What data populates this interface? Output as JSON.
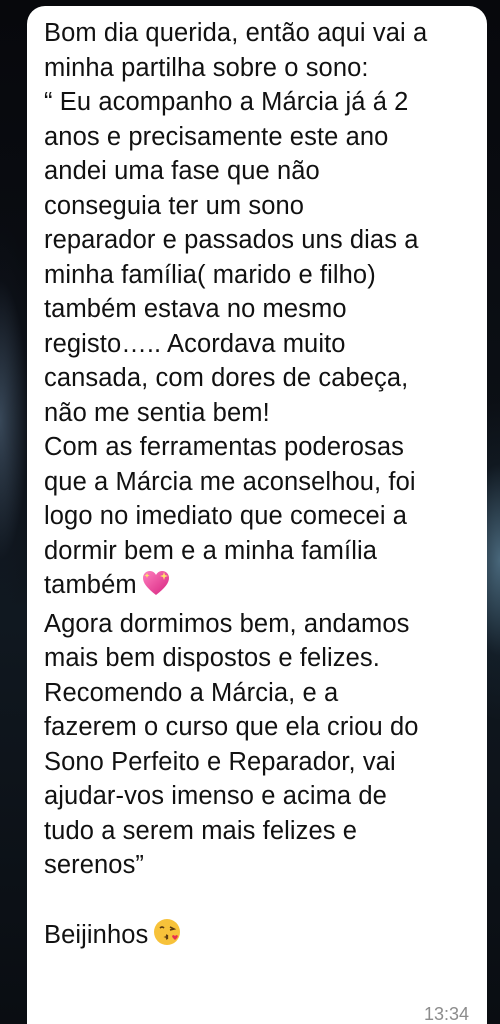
{
  "message": {
    "lines_before_heart": "Bom dia querida, então aqui vai a\nminha partilha sobre o sono:\n“ Eu acompanho a Márcia já á 2\nanos e precisamente este ano\nandei uma fase que não\nconseguia ter um sono\nreparador e passados uns dias a\nminha família( marido e filho)\ntambém estava no mesmo\nregisto….. Acordava muito\ncansada, com dores de cabeça,\nnão me sentia bem!\nCom as ferramentas poderosas\nque a Márcia me aconselhou, foi\nlogo no imediato que comecei a\ndormir bem e a minha família\ntambém",
    "heart_emoji": "sparkling-heart-icon",
    "lines_after_heart": "Agora dormimos bem, andamos\nmais bem dispostos e felizes.\nRecomendo a Márcia, e a\nfazerem o curso que ela criou do\nSono Perfeito e Reparador, vai\najudar-vos imenso e acima de\ntudo a serem mais felizes e\nserenos”",
    "closing": "Beijinhos",
    "closing_emoji": "kissing-face-icon",
    "timestamp": "13:34"
  },
  "colors": {
    "bubble": "#ffffff",
    "text": "#111111",
    "timestamp": "#8c8c8c",
    "heart": "#e84b9a",
    "emoji_face": "#f7c23a"
  }
}
